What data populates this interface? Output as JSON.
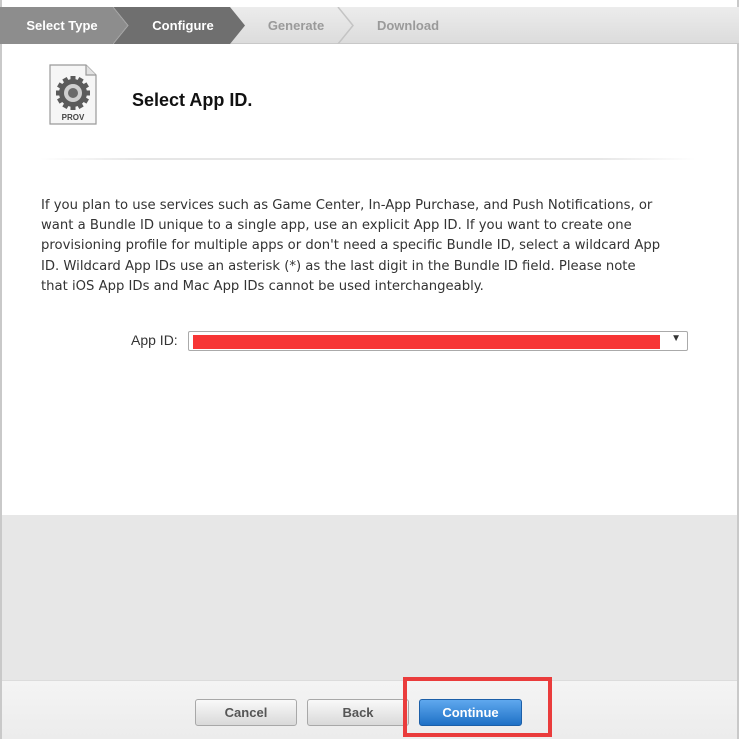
{
  "steps": [
    {
      "label": "Select Type",
      "state": "done"
    },
    {
      "label": "Configure",
      "state": "current"
    },
    {
      "label": "Generate",
      "state": "upcoming"
    },
    {
      "label": "Download",
      "state": "upcoming"
    }
  ],
  "header": {
    "icon_label": "PROV",
    "title": "Select App ID."
  },
  "description": "If you plan to use services such as Game Center, In-App Purchase, and Push Notifications, or want a Bundle ID unique to a single app, use an explicit App ID. If you want to create one provisioning profile for multiple apps or don't need a specific Bundle ID, select a wildcard App ID. Wildcard App IDs use an asterisk (*) as the last digit in the Bundle ID field. Please note that iOS App IDs and Mac App IDs cannot be used interchangeably.",
  "form": {
    "app_id_label": "App ID:",
    "app_id_value": "",
    "app_id_redacted": true
  },
  "footer": {
    "cancel_label": "Cancel",
    "back_label": "Back",
    "continue_label": "Continue"
  },
  "colors": {
    "step_done_bg": "#8d8d8d",
    "step_current_bg": "#6f6f6f",
    "primary_button": "#2a7fd4",
    "highlight": "#ea3c3c",
    "redaction": "#f73535"
  }
}
